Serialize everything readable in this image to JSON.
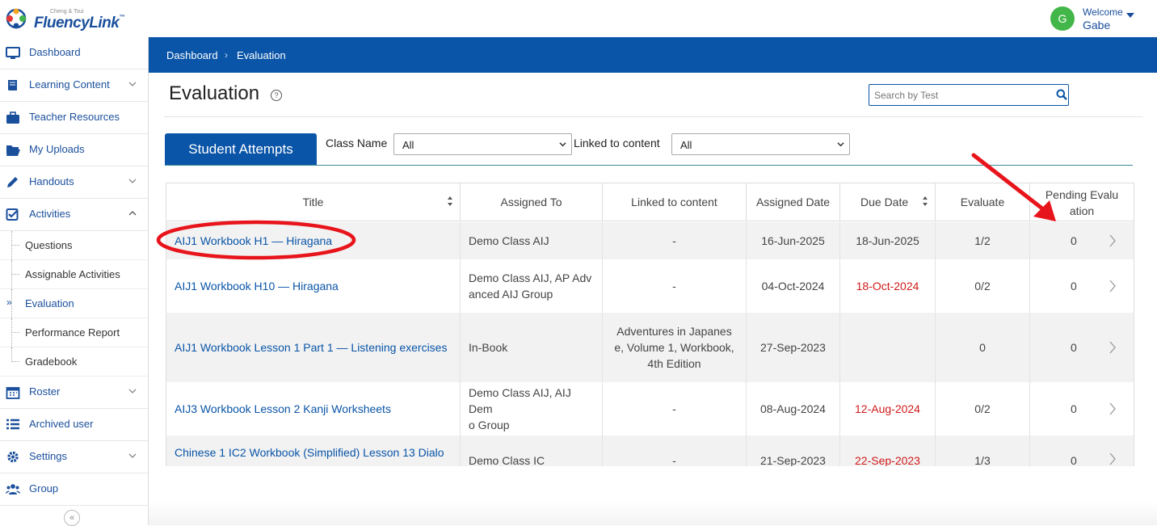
{
  "brand": {
    "sup": "Cheng & Tsui",
    "name": "FluencyLink",
    "tm": "™"
  },
  "user": {
    "initial": "G",
    "welcome": "Welcome",
    "name": "Gabe"
  },
  "sidebar": {
    "items": [
      {
        "label": "Dashboard",
        "icon": "monitor-icon"
      },
      {
        "label": "Learning Content",
        "icon": "book-icon"
      },
      {
        "label": "Teacher Resources",
        "icon": "briefcase-icon"
      },
      {
        "label": "My Uploads",
        "icon": "folder-open-icon"
      },
      {
        "label": "Handouts",
        "icon": "pencil-icon"
      },
      {
        "label": "Activities",
        "icon": "check-square-icon"
      },
      {
        "label": "Roster",
        "icon": "calendar-icon"
      },
      {
        "label": "Archived user",
        "icon": "list-icon"
      },
      {
        "label": "Settings",
        "icon": "gear-icon"
      },
      {
        "label": "Group",
        "icon": "users-icon"
      }
    ],
    "sub_items": [
      {
        "label": "Questions"
      },
      {
        "label": "Assignable Activities"
      },
      {
        "label": "Evaluation",
        "active": true,
        "marker": "»"
      },
      {
        "label": "Performance Report"
      },
      {
        "label": "Gradebook"
      }
    ],
    "collapse_glyph": "«"
  },
  "breadcrumb": {
    "items": [
      "Dashboard",
      "Evaluation"
    ],
    "separator": "›"
  },
  "page": {
    "title": "Evaluation",
    "help_glyph": "?"
  },
  "search": {
    "placeholder": "Search by Test"
  },
  "tabs": [
    {
      "label": "Student Attempts",
      "active": true
    }
  ],
  "filters": {
    "class_name": {
      "label": "Class Name",
      "value": "All"
    },
    "linked": {
      "label": "Linked to content",
      "value": "All"
    }
  },
  "table": {
    "headers": [
      "Title",
      "Assigned To",
      "Linked to content",
      "Assigned Date",
      "Due Date",
      "Evaluate",
      "Pending Evaluation"
    ],
    "headers_wrapped": {
      "pending_1": "Pending Evalu",
      "pending_2": "ation"
    },
    "rows": [
      {
        "title": "AIJ1 Workbook H1 — Hiragana",
        "assigned_to": [
          "Demo Class AIJ"
        ],
        "linked": [
          "-"
        ],
        "assigned": "16-Jun-2025",
        "due": "18-Jun-2025",
        "due_overdue": false,
        "evaluate": "1/2",
        "pending": "0"
      },
      {
        "title": "AIJ1 Workbook H10 — Hiragana",
        "assigned_to": [
          "Demo Class AIJ, AP Adv",
          "anced AIJ Group"
        ],
        "linked": [
          "-"
        ],
        "assigned": "04-Oct-2024",
        "due": "18-Oct-2024",
        "due_overdue": true,
        "evaluate": "0/2",
        "pending": "0"
      },
      {
        "title": "AIJ1 Workbook Lesson 1 Part 1 — Listening exercises",
        "assigned_to": [
          "In-Book"
        ],
        "linked": [
          "Adventures in Japanes",
          "e, Volume 1, Workbook,",
          "4th Edition"
        ],
        "assigned": "27-Sep-2023",
        "due": "",
        "due_overdue": false,
        "evaluate": "0",
        "pending": "0"
      },
      {
        "title": "AIJ3 Workbook Lesson 2 Kanji Worksheets",
        "assigned_to": [
          "Demo Class AIJ, AIJ Dem",
          "o Group"
        ],
        "linked": [
          "-"
        ],
        "assigned": "08-Aug-2024",
        "due": "12-Aug-2024",
        "due_overdue": true,
        "evaluate": "0/2",
        "pending": "0"
      },
      {
        "title": "Chinese 1 IC2 Workbook (Simplified) Lesson 13 Dialo",
        "assigned_to": [
          "Demo Class IC"
        ],
        "linked": [
          "-"
        ],
        "assigned": "21-Sep-2023",
        "due": "22-Sep-2023",
        "due_overdue": true,
        "evaluate": "1/3",
        "pending": "0"
      }
    ]
  },
  "colors": {
    "brand_blue": "#0a55a8",
    "overdue_red": "#d01a1a",
    "annotation_red": "#e8141b",
    "avatar_green": "#43b649"
  }
}
